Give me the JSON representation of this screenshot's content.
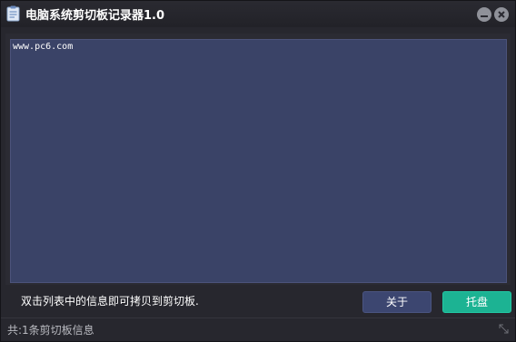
{
  "window": {
    "title": "电脑系统剪切板记录器1.0",
    "minimize_icon": "minimize-icon",
    "close_icon": "close-icon"
  },
  "clipboard_list": {
    "items": [
      "www.pc6.com"
    ]
  },
  "footer": {
    "hint": "双击列表中的信息即可拷贝到剪切板.",
    "about_label": "关于",
    "tray_label": "托盘"
  },
  "status_bar": {
    "text": "共:1条剪切板信息"
  },
  "colors": {
    "list_background": "#3a4367",
    "about_button": "#3c4670",
    "tray_button": "#1cb393"
  }
}
